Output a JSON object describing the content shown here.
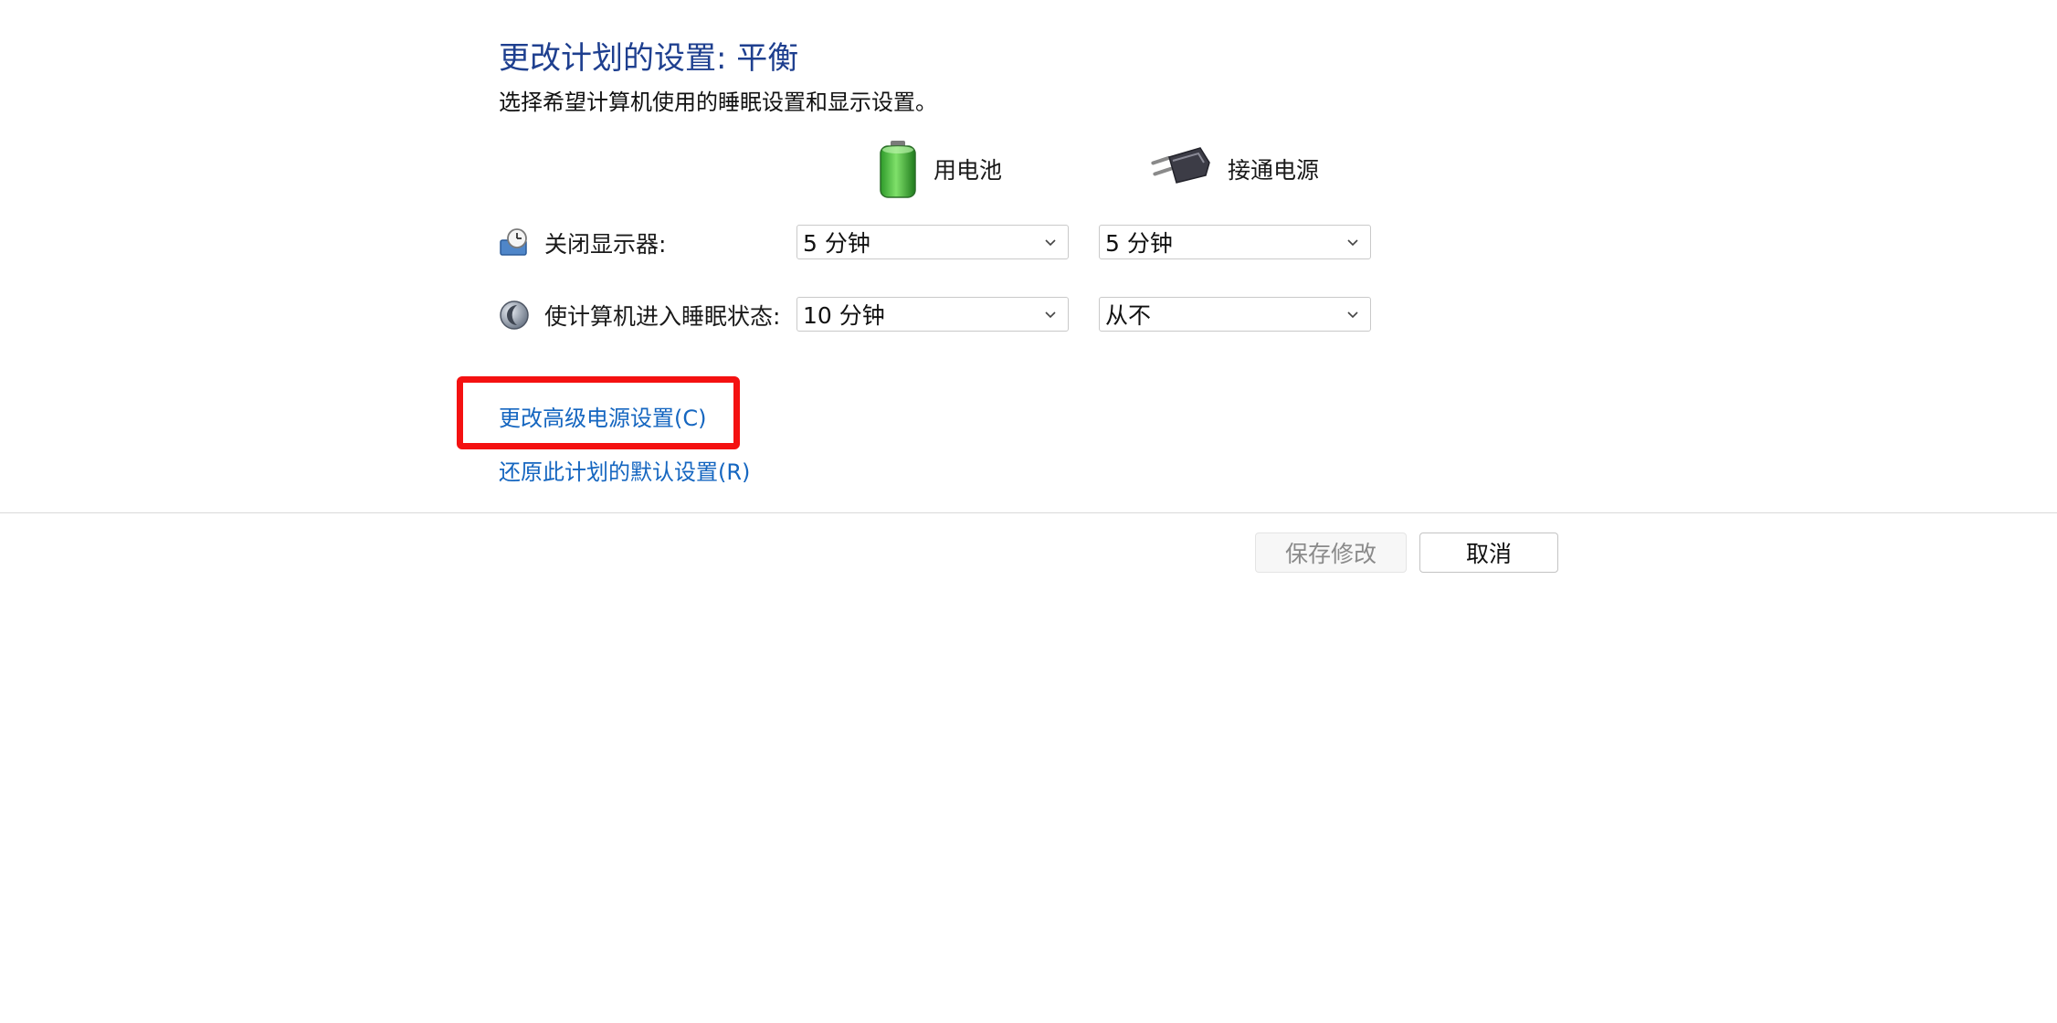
{
  "page": {
    "title": "更改计划的设置: 平衡",
    "subtitle": "选择希望计算机使用的睡眠设置和显示设置。"
  },
  "columns": {
    "battery": {
      "label": "用电池",
      "icon": "battery-icon"
    },
    "plugged_in": {
      "label": "接通电源",
      "icon": "power-plug-icon"
    }
  },
  "settings": [
    {
      "label": "关闭显示器:",
      "icon": "monitor-clock-icon",
      "battery_value": "5 分钟",
      "plugged_value": "5 分钟"
    },
    {
      "label": "使计算机进入睡眠状态:",
      "icon": "sleep-moon-icon",
      "battery_value": "10 分钟",
      "plugged_value": "从不"
    }
  ],
  "links": {
    "advanced": "更改高级电源设置(C)",
    "restore": "还原此计划的默认设置(R)"
  },
  "buttons": {
    "save": "保存修改",
    "cancel": "取消"
  },
  "colors": {
    "title": "#1e3f8f",
    "link": "#1566c0",
    "highlight": "#f41111"
  }
}
